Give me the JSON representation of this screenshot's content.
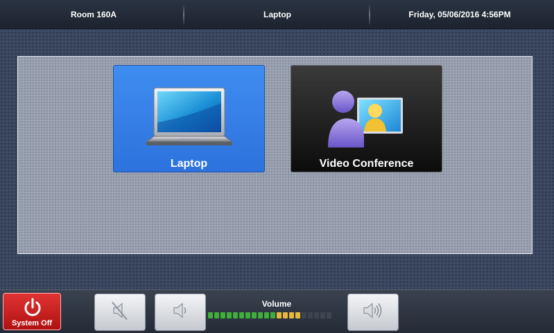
{
  "header": {
    "room": "Room 160A",
    "source": "Laptop",
    "datetime": "Friday, 05/06/2016 4:56PM"
  },
  "sources": [
    {
      "label": "Laptop",
      "icon": "laptop-icon",
      "selected": true
    },
    {
      "label": "Video Conference",
      "icon": "video-conference-icon",
      "selected": false
    }
  ],
  "footer": {
    "system_off_label": "System Off",
    "volume_label": "Volume",
    "mute_icon": "mute-icon",
    "volume_down_icon": "volume-down-icon",
    "volume_up_icon": "volume-up-icon",
    "volume_level_segments": 15,
    "volume_total_segments": 20
  },
  "colors": {
    "selected_source": "#3a86ee",
    "unselected_source": "#111111",
    "system_off": "#cc2020",
    "meter_green": "#3fae3a",
    "meter_yellow": "#e7b83a",
    "meter_off": "#3f454f"
  }
}
